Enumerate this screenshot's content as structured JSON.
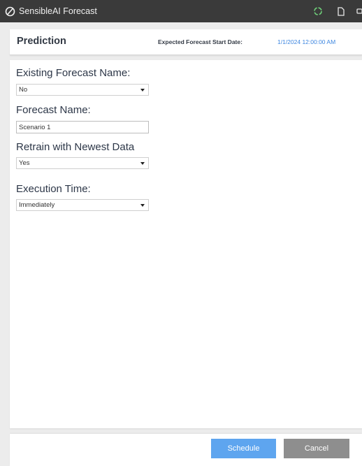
{
  "window": {
    "title": "SensibleAI Forecast",
    "icons": [
      "sensibleai-logo-icon",
      "refresh-icon",
      "document-icon",
      "more-icon"
    ]
  },
  "header": {
    "title": "Prediction",
    "start_date_label": "Expected Forecast Start Date:",
    "start_date_value": "1/1/2024 12:00:00 AM"
  },
  "form": {
    "existing_forecast": {
      "label": "Existing Forecast Name:",
      "value": "No"
    },
    "forecast_name": {
      "label": "Forecast Name:",
      "value": "Scenario 1"
    },
    "retrain": {
      "label": "Retrain with Newest Data",
      "value": "Yes"
    },
    "execution_time": {
      "label": "Execution Time:",
      "value": "Immediately"
    }
  },
  "footer": {
    "schedule_label": "Schedule",
    "cancel_label": "Cancel"
  },
  "colors": {
    "titlebar": "#3a3a3a",
    "accent": "#3d86e0",
    "schedule_button": "#5ea5ef",
    "cancel_button": "#8e8e8e",
    "refresh_icon": "#6fd07a"
  }
}
